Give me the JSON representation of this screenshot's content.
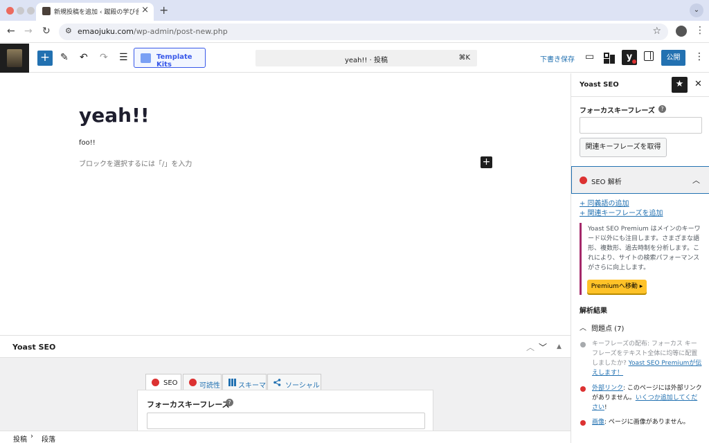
{
  "browser": {
    "tab_title": "新規投稿を追加 ‹ 蹴殿の学び舎 —",
    "url_host": "emaojuku.com",
    "url_path": "/wp-admin/post-new.php"
  },
  "wp_header": {
    "template_kits_label": "Template Kits",
    "command_title": "yeah!! · 投稿",
    "command_shortcut": "⌘K",
    "save_draft_label": "下書き保存",
    "yoast_label": "y",
    "publish_label": "公開"
  },
  "editor": {
    "title": "yeah!!",
    "paragraph": "foo!!",
    "placeholder": "ブロックを選択するには「/」を入力"
  },
  "metabox": {
    "title": "Yoast SEO",
    "tabs": [
      {
        "label": "SEO"
      },
      {
        "label": "可読性"
      },
      {
        "label": "スキーマ"
      },
      {
        "label": "ソーシャル"
      }
    ],
    "focus_label": "フォーカスキーフレーズ",
    "focus_value": ""
  },
  "footer": {
    "crumbs": [
      "投稿",
      "段落"
    ],
    "separator": "›"
  },
  "sidebar": {
    "title": "Yoast SEO",
    "focus_label": "フォーカスキーフレーズ",
    "focus_value": "",
    "related_button": "関連キーフレーズを取得",
    "seo_analysis_label": "SEO 解析",
    "add_synonyms": "+ 同義語の追加",
    "add_related": "+ 関連キーフレーズを追加",
    "premium_text": "Yoast SEO Premium はメインのキーワード以外にも注目します。さまざまな語形、複数形、過去時制を分析します。これにより、サイトの検索パフォーマンスがさらに向上します。",
    "premium_button": "Premiumへ移動 ▸",
    "results_heading": "解析結果",
    "problems_label": "問題点 (7)",
    "results": [
      {
        "status": "gray",
        "text": "キーフレーズの配布: フォーカス キーフレーズをテキスト全体に均等に配置しましたか? ",
        "link": "Yoast SEO Premiumが伝えします！"
      },
      {
        "status": "red",
        "link_lead": "外部リンク",
        "text": ": このページには外部リンクがありません。",
        "link": "いくつか追加してください",
        "tail": "!"
      },
      {
        "status": "red",
        "link_lead": "画像",
        "text": ": ページに画像がありません。"
      }
    ]
  },
  "colors": {
    "wp_blue": "#2271b1",
    "yoast_red": "#dc3232",
    "premium_yellow": "#fec228",
    "premium_border": "#a4286a"
  }
}
